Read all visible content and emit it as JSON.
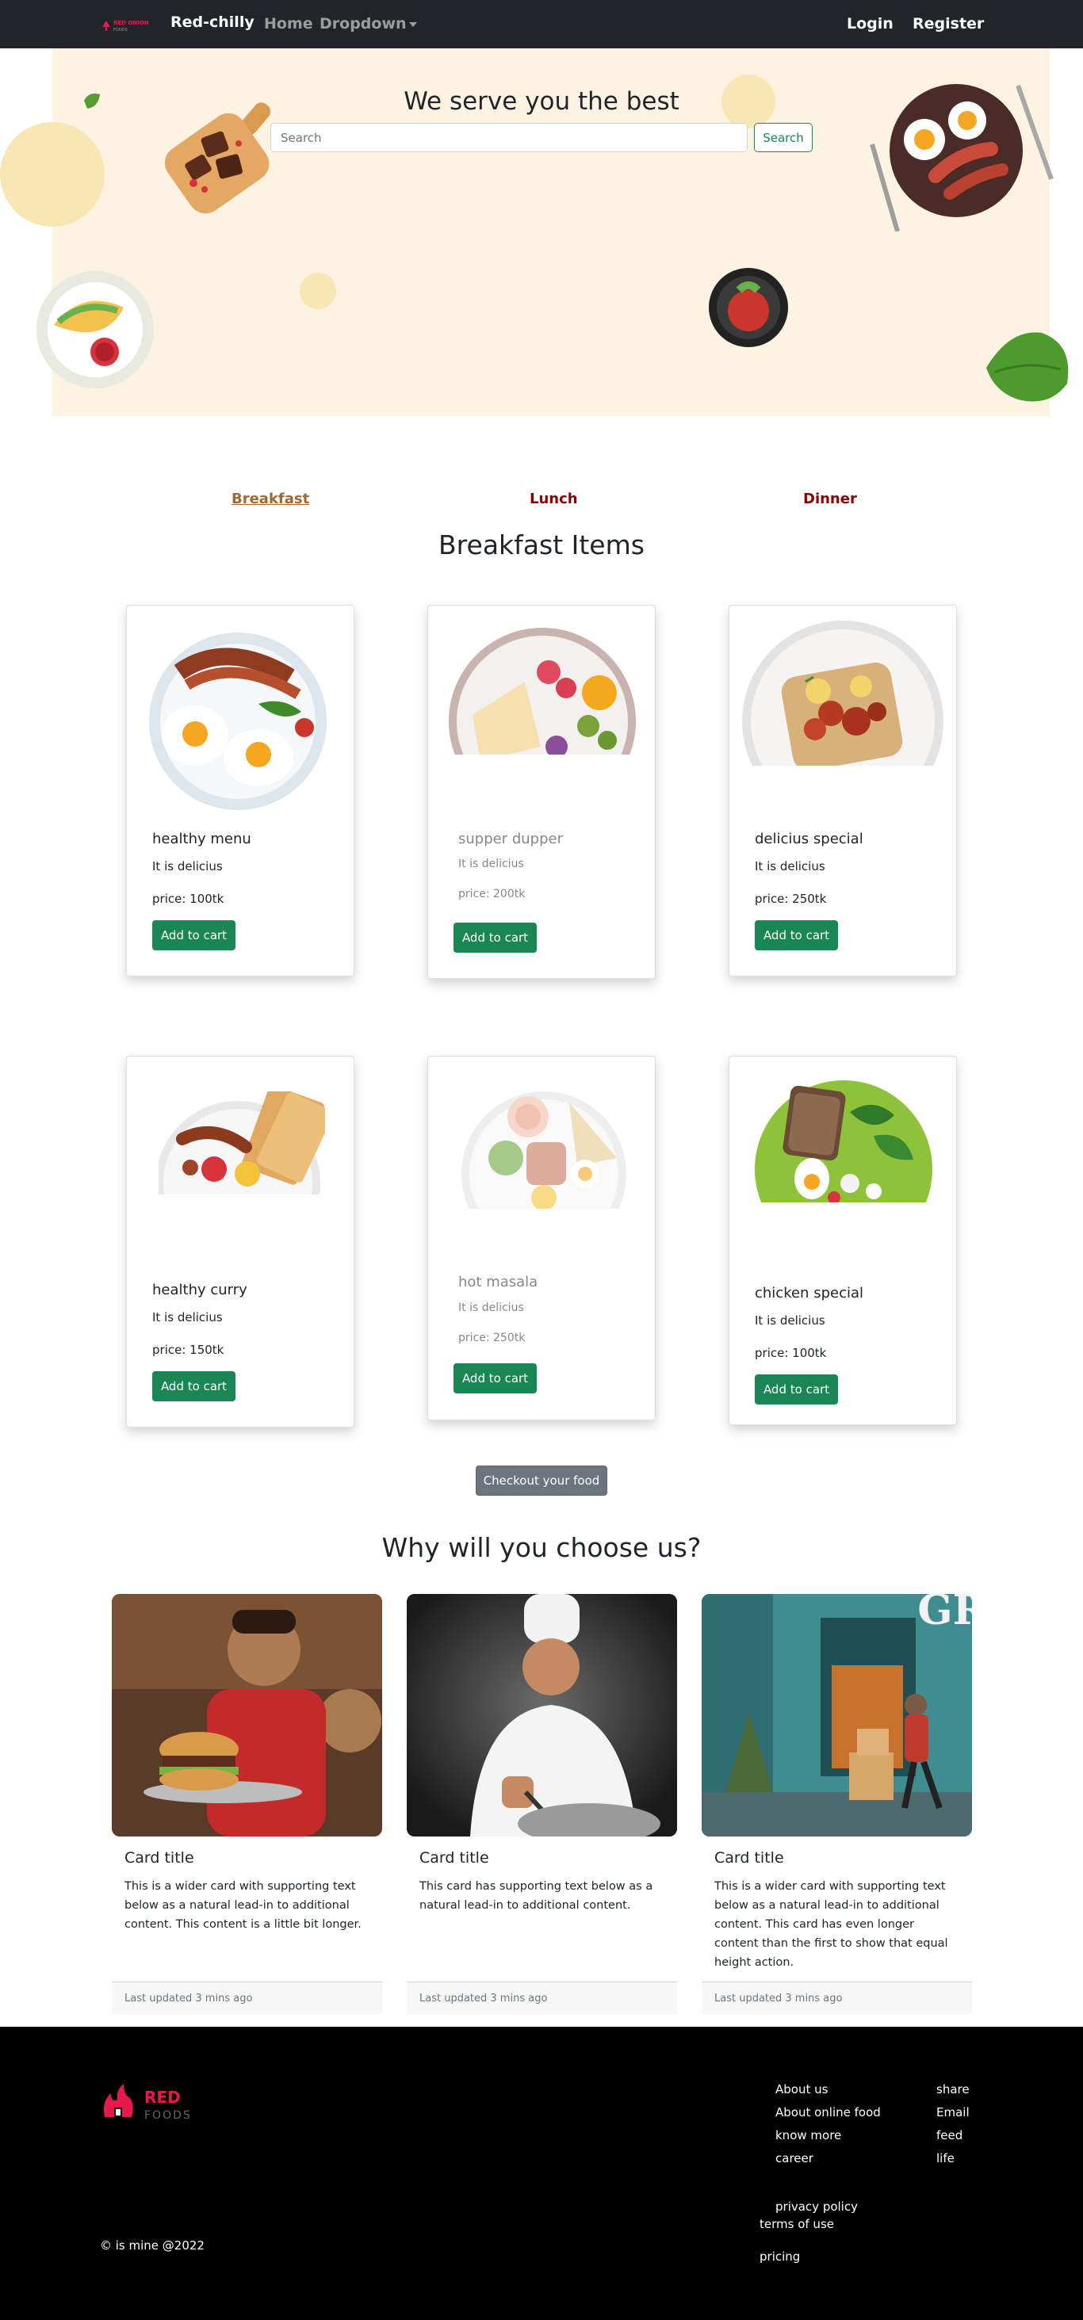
{
  "navbar": {
    "logo_text_top": "RED ONION",
    "logo_text_bottom": "FOODS",
    "brand": "Red-chilly",
    "home": "Home",
    "dropdown": "Dropdown",
    "login": "Login",
    "register": "Register"
  },
  "hero": {
    "title": "We serve you the best",
    "search_placeholder": "Search",
    "search_button": "Search"
  },
  "categories": {
    "breakfast": "Breakfast",
    "lunch": "Lunch",
    "dinner": "Dinner"
  },
  "menu": {
    "section_title": "Breakfast Items",
    "items": [
      {
        "name": "healthy menu",
        "desc": "It is delicius",
        "price": "price: 100tk",
        "button": "Add to cart"
      },
      {
        "name": "supper dupper",
        "desc": "It is delicius",
        "price": "price: 200tk",
        "button": "Add to cart"
      },
      {
        "name": "delicius special",
        "desc": "It is delicius",
        "price": "price: 250tk",
        "button": "Add to cart"
      },
      {
        "name": "healthy curry",
        "desc": "It is delicius",
        "price": "price: 150tk",
        "button": "Add to cart"
      },
      {
        "name": "hot masala",
        "desc": "It is delicius",
        "price": "price: 250tk",
        "button": "Add to cart"
      },
      {
        "name": "chicken special",
        "desc": "It is delicius",
        "price": "price: 100tk",
        "button": "Add to cart"
      }
    ],
    "checkout": "Checkout your food"
  },
  "why": {
    "title": "Why will you choose us?",
    "cards": [
      {
        "title": "Card title",
        "text": "This is a wider card with supporting text below as a natural lead-in to additional content. This content is a little bit longer.",
        "updated": "Last updated 3 mins ago"
      },
      {
        "title": "Card title",
        "text": "This card has supporting text below as a natural lead-in to additional content.",
        "updated": "Last updated 3 mins ago"
      },
      {
        "title": "Card title",
        "text": "This is a wider card with supporting text below as a natural lead-in to additional content. This card has even longer content than the first to show that equal height action.",
        "updated": "Last updated 3 mins ago"
      }
    ],
    "storefront_sign": "GR"
  },
  "footer": {
    "logo_red": "RED",
    "logo_foods": "FOODS",
    "col1": [
      "About us",
      "About online food",
      "know more",
      "career"
    ],
    "col2": [
      "share",
      "Email",
      "feed",
      "life"
    ],
    "privacy": "privacy policy",
    "terms": "terms of use",
    "pricing": "pricing",
    "copyright": "© is mine @2022"
  },
  "colors": {
    "navbar": "#212529",
    "hero_bg": "#fcf3e2",
    "success": "#198754",
    "secondary": "#6c757d",
    "category": "#8b0000",
    "category_active": "#a0692f",
    "footer": "#000000"
  }
}
